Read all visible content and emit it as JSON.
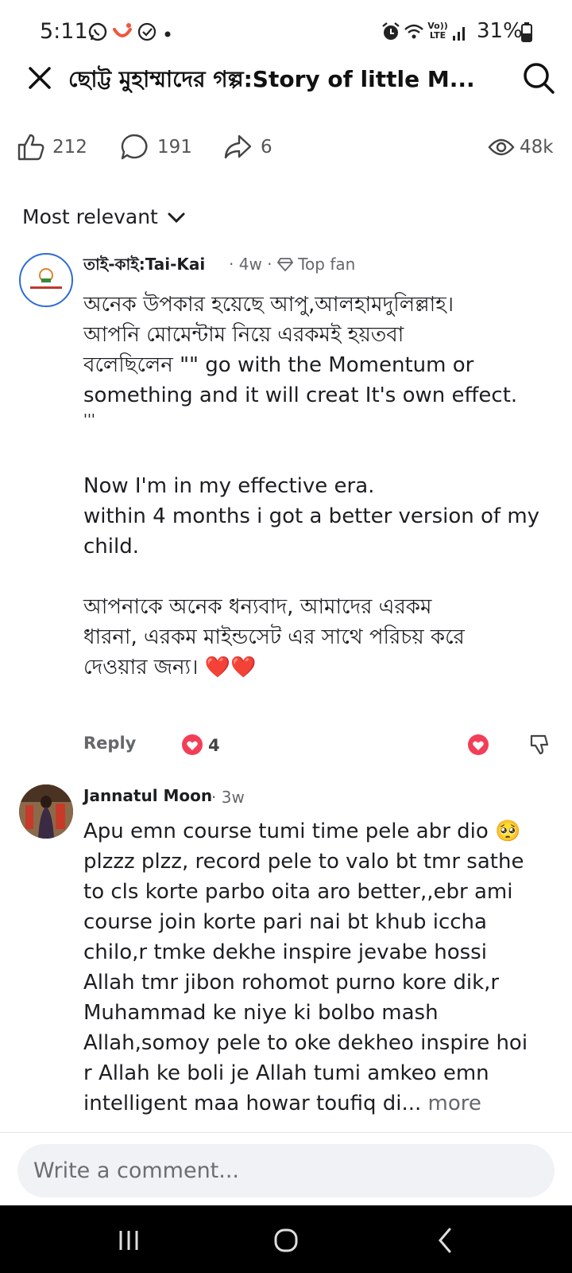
{
  "status_bar": {
    "time": "5:11",
    "battery": "31%",
    "icons": [
      "whatsapp-icon",
      "app-icon",
      "check-circle-icon",
      "dot-icon",
      "alarm-icon",
      "wifi-icon",
      "volte-icon",
      "signal-icon",
      "battery-icon"
    ],
    "volte_label": "Vo)) LTE"
  },
  "header": {
    "title": "ছোট্ট মুহাম্মাদের গল্প:Story of little M..."
  },
  "reactions": {
    "likes": "212",
    "comments": "191",
    "shares": "6",
    "views": "48k"
  },
  "sort": {
    "label": "Most relevant"
  },
  "comments": [
    {
      "author": "তাই-কাই:Tai-Kai",
      "time": "· 4w ·",
      "badge": "Top fan",
      "body": [
        "অনেক উপকার হয়েছে আপু,আলহামদুলিল্লাহ।",
        "আপনি মোমেন্টাম নিয়ে এরকমই হয়তবা",
        "বলেছিলেন  \"\" go with the Momentum or",
        "something and it will creat It's own effect.",
        "'''",
        "",
        "Now I'm in my effective era.",
        "within 4 months i got a better version of my",
        "child.",
        "",
        "আপনাকে অনেক ধন্যবাদ, আমাদের এরকম",
        "ধারনা, এরকম মাইন্ডসেট এর সাথে পরিচয় করে",
        "দেওয়ার জন্য। ❤️❤️"
      ],
      "reply_label": "Reply",
      "reaction_count": "4"
    },
    {
      "author": "Jannatul Moon",
      "time": "· 3w",
      "body": [
        "Apu emn course tumi time pele abr dio 🥺",
        "plzzz plzz, record pele to valo bt tmr sathe",
        "to cls korte parbo oita aro better,,ebr ami",
        "course join korte pari nai bt khub iccha",
        "chilo,r tmke dekhe inspire jevabe hossi",
        "Allah tmr jibon rohomot purno kore dik,r",
        "Muhammad ke niye ki bolbo mash",
        "Allah,somoy pele to oke dekheo inspire hoi",
        "r Allah ke boli je Allah tumi amkeo emn"
      ],
      "last_line": "intelligent maa howar toufiq di...",
      "more_label": "more"
    }
  ],
  "composer": {
    "placeholder": "Write a comment..."
  },
  "nav": {
    "icons": [
      "recents-icon",
      "home-icon",
      "back-icon"
    ]
  },
  "colors": {
    "text": "#1c1e21",
    "secondary": "#65676b",
    "love": "#f33e58",
    "composer_bg": "#f0f2f5",
    "navbar": "#000000"
  }
}
